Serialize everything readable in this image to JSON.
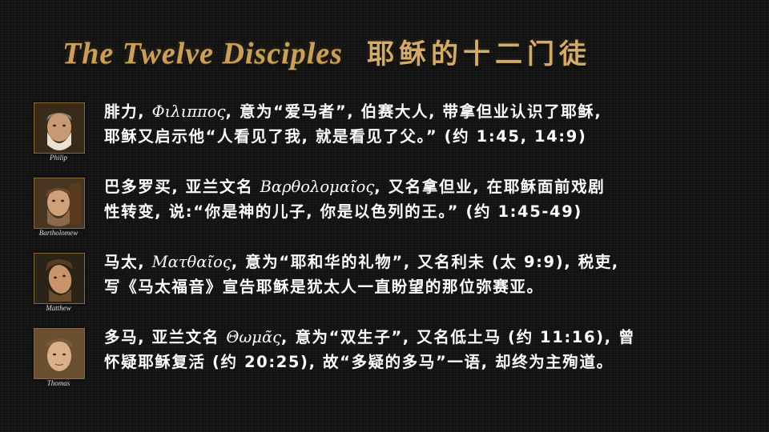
{
  "header": {
    "title_en": "The Twelve Disciples",
    "title_zh": "耶稣的十二门徒"
  },
  "disciples": [
    {
      "name_en": "Philip",
      "line1_a": "腓力, ",
      "line1_greek": "Φιλιππος",
      "line1_b": ", 意为“爱马者”, 伯赛大人, 带拿但业认识了耶稣,",
      "line2": "耶稣又启示他“人看见了我, 就是看见了父。” (约 1:45, 14:9)"
    },
    {
      "name_en": "Bartholomew",
      "line1_a": "巴多罗买, 亚兰文名 ",
      "line1_greek": "Βαρθολομαῖος",
      "line1_b": ", 又名拿但业, 在耶稣面前戏剧",
      "line2": "性转变, 说:“你是神的儿子, 你是以色列的王。” (约 1:45-49)"
    },
    {
      "name_en": "Matthew",
      "line1_a": "马太, ",
      "line1_greek": "Ματθαῖος",
      "line1_b": ", 意为“耶和华的礼物”, 又名利未 (太 9:9), 税吏,",
      "line2": "写《马太福音》宣告耶稣是犹太人一直盼望的那位弥赛亚。"
    },
    {
      "name_en": "Thomas",
      "line1_a": "多马, 亚兰文名 ",
      "line1_greek": "Θωμᾶς",
      "line1_b": ", 意为“双生子”, 又名低土马 (约 11:16), 曾",
      "line2": "怀疑耶稣复活 (约 20:25), 故“多疑的多马”一语, 却终为主殉道。"
    }
  ]
}
